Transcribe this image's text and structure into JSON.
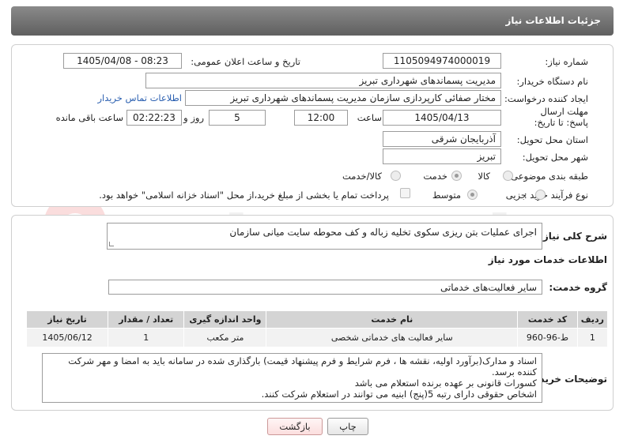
{
  "header": {
    "title": "جزئیات اطلاعات نیاز"
  },
  "form": {
    "need_number_label": "شماره نیاز:",
    "need_number": "1105094974000019",
    "announce_label": "تاریخ و ساعت اعلان عمومی:",
    "announce_value": "1405/04/08 - 08:23",
    "buyer_org_label": "نام دستگاه خریدار:",
    "buyer_org": "مدیریت پسماندهای شهرداری تبریز",
    "creator_label": "ایجاد کننده درخواست:",
    "creator": "مختار صفائی کارپردازی سازمان مدیریت پسماندهای شهرداری تبریز",
    "contact_link": "اطلاعات تماس خریدار",
    "deadline_label": "مهلت ارسال پاسخ: تا تاریخ:",
    "deadline_date": "1405/04/13",
    "time_label": "ساعت",
    "deadline_time": "12:00",
    "days_value": "5",
    "days_label": "روز و",
    "remaining_time": "02:22:23",
    "remaining_label": "ساعت باقی مانده",
    "province_label": "استان محل تحویل:",
    "province": "آذربایجان شرقی",
    "city_label": "شهر محل تحویل:",
    "city": "تبریز",
    "category_label": "طبقه بندی موضوعی:",
    "category_options": [
      "کالا",
      "خدمت",
      "کالا/خدمت"
    ],
    "category_selected": "خدمت",
    "process_label": "نوع فرآیند خرید :",
    "process_options": [
      "جزیی",
      "متوسط"
    ],
    "process_selected": "متوسط",
    "payment_note": "پرداخت تمام یا بخشی از مبلغ خرید،از محل \"اسناد خزانه اسلامی\" خواهد بود."
  },
  "summary": {
    "label": "شرح کلی نیاز:",
    "value": "اجرای عملیات بتن ریزی سکوی تخلیه زباله و کف محوطه سایت میانی سازمان"
  },
  "services": {
    "section_title": "اطلاعات خدمات مورد نیاز",
    "group_label": "گروه خدمت:",
    "group_value": "سایر فعالیت‌های خدماتی",
    "columns": [
      "ردیف",
      "کد خدمت",
      "نام خدمت",
      "واحد اندازه گیری",
      "تعداد / مقدار",
      "تاریخ نیاز"
    ],
    "rows": [
      [
        "1",
        "ط-96-960",
        "سایر فعالیت های خدماتی شخصی",
        "متر مکعب",
        "1",
        "1405/06/12"
      ]
    ]
  },
  "buyer_notes": {
    "label": "توضیحات خریدار:",
    "lines": [
      "اسناد و مدارک(برآورد اولیه، نقشه ها ، فرم شرایط و فرم پیشنهاد قیمت) بارگذاری شده در سامانه باید به امضا و مهر شرکت کننده برسد.",
      "کسورات قانونی بر عهده برنده استعلام  می باشد",
      "اشخاص حقوقی دارای رتبه 5(پنج) ابنیه می توانند در استعلام شرکت کنند."
    ]
  },
  "buttons": {
    "print": "چاپ",
    "back": "بازگشت"
  },
  "watermark": "AriaTender.net",
  "colors": {
    "header": "#6e6e6e",
    "link": "#2a5fb0",
    "back_button": "#fde8e8"
  }
}
